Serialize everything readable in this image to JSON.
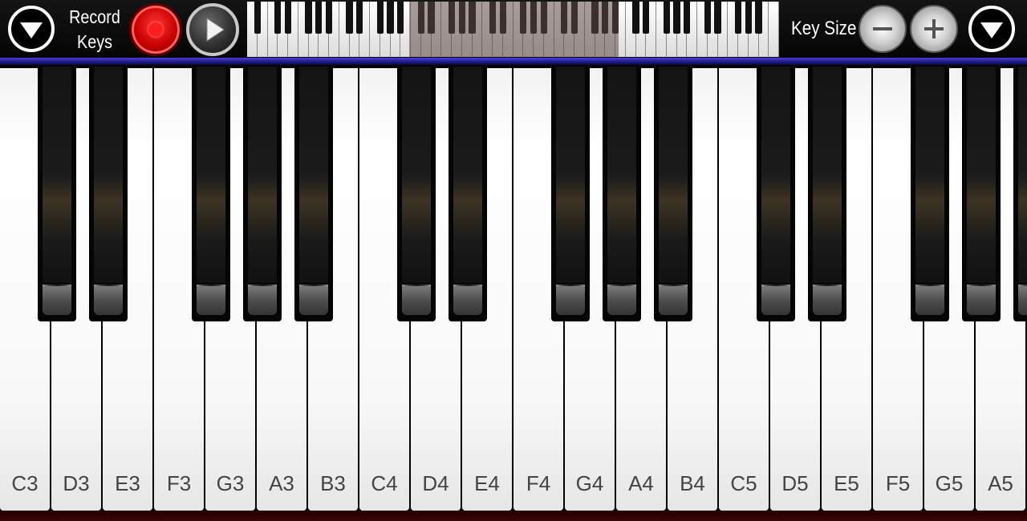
{
  "toolbar": {
    "record_line1": "Record",
    "record_line2": "Keys",
    "key_size_label": "Key Size",
    "icons": {
      "menu_left": "triangle-down-icon",
      "record": "record-icon",
      "play": "play-icon",
      "minus": "minus-icon",
      "plus": "plus-icon",
      "menu_right": "triangle-down-icon"
    },
    "colors": {
      "record": "#d60000",
      "stripe": "#2b27b0"
    }
  },
  "mini_keyboard": {
    "white_key_count": 52,
    "viewport_first_key": "C3",
    "viewport_last_key": "A5"
  },
  "keyboard": {
    "white_keys": [
      "C3",
      "D3",
      "E3",
      "F3",
      "G3",
      "A3",
      "B3",
      "C4",
      "D4",
      "E4",
      "F4",
      "G4",
      "A4",
      "B4",
      "C5",
      "D5",
      "E5",
      "F5",
      "G5",
      "A5"
    ],
    "black_keys": [
      "C#3",
      "D#3",
      "F#3",
      "G#3",
      "A#3",
      "C#4",
      "D#4",
      "F#4",
      "G#4",
      "A#4",
      "C#5",
      "D#5",
      "F#5",
      "G#5",
      "A#5"
    ]
  }
}
